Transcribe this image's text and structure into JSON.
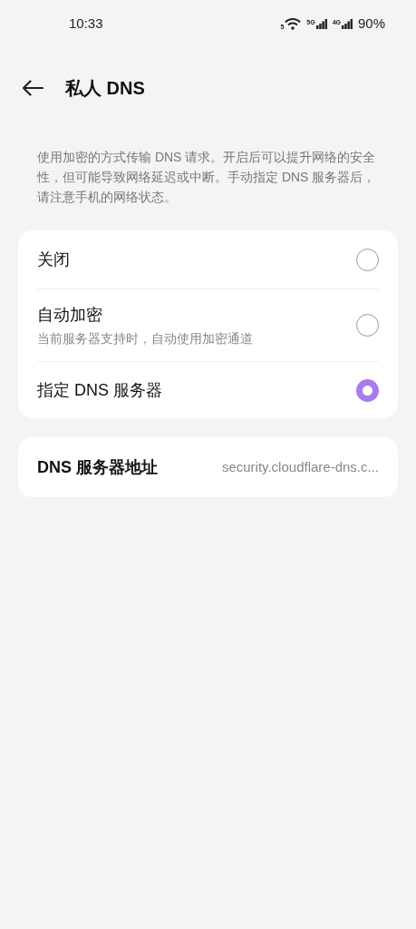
{
  "status_bar": {
    "time": "10:33",
    "wifi_badge": "5",
    "sim_1": "5G",
    "sim_2": "4G",
    "battery": "90%"
  },
  "header": {
    "title": "私人 DNS"
  },
  "description": "使用加密的方式传输 DNS 请求。开启后可以提升网络的安全性，但可能导致网络延迟或中断。手动指定 DNS 服务器后，请注意手机的网络状态。",
  "options": [
    {
      "label": "关闭",
      "selected": false
    },
    {
      "label": "自动加密",
      "subtitle": "当前服务器支持时，自动使用加密通道",
      "selected": false
    },
    {
      "label": "指定 DNS 服务器",
      "selected": true
    }
  ],
  "server": {
    "label": "DNS 服务器地址",
    "value": "security.cloudflare-dns.c..."
  }
}
